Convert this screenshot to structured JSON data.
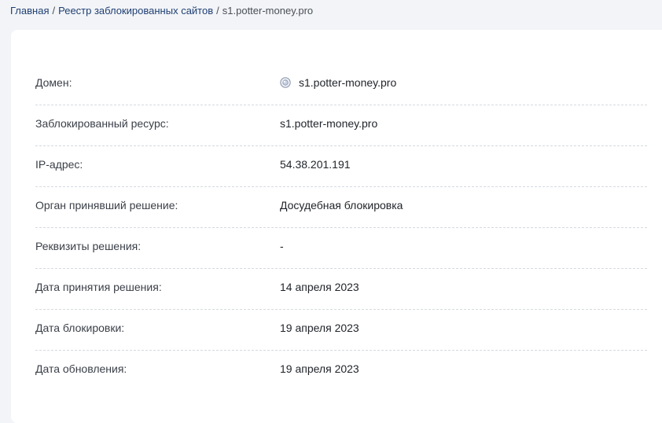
{
  "breadcrumb": {
    "home": "Главная",
    "registry": "Реестр заблокированных сайтов",
    "current": "s1.potter-money.pro",
    "separator": "/"
  },
  "rows": [
    {
      "label": "Домен:",
      "value": "s1.potter-money.pro",
      "icon": "globe-icon"
    },
    {
      "label": "Заблокированный ресурс:",
      "value": "s1.potter-money.pro"
    },
    {
      "label": "IP-адрес:",
      "value": "54.38.201.191"
    },
    {
      "label": "Орган принявший решение:",
      "value": "Досудебная блокировка"
    },
    {
      "label": "Реквизиты решения:",
      "value": "-"
    },
    {
      "label": "Дата принятия решения:",
      "value": "14 апреля 2023"
    },
    {
      "label": "Дата блокировки:",
      "value": "19 апреля 2023"
    },
    {
      "label": "Дата обновления:",
      "value": "19 апреля 2023"
    }
  ]
}
